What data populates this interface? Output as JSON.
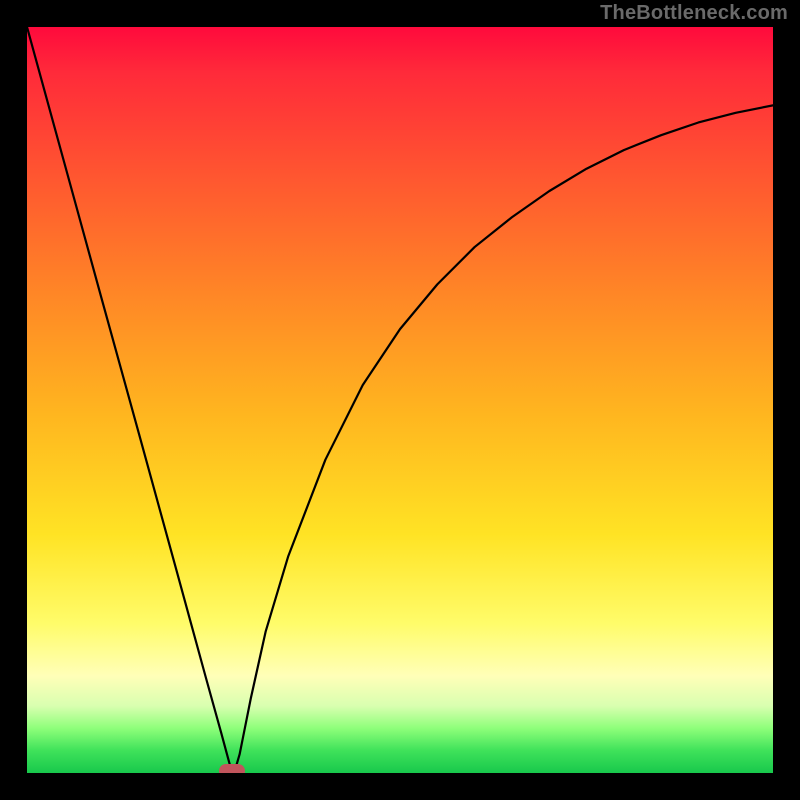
{
  "watermark": {
    "text": "TheBottleneck.com"
  },
  "chart_data": {
    "type": "line",
    "title": "",
    "xlabel": "",
    "ylabel": "",
    "xlim": [
      0,
      100
    ],
    "ylim": [
      0,
      100
    ],
    "grid": false,
    "legend": false,
    "series": [
      {
        "name": "bottleneck-curve",
        "x": [
          0,
          5,
          10,
          15,
          20,
          22,
          24,
          26,
          27,
          27.5,
          28,
          28.5,
          29,
          30,
          32,
          35,
          40,
          45,
          50,
          55,
          60,
          65,
          70,
          75,
          80,
          85,
          90,
          95,
          100
        ],
        "values": [
          100,
          81.8,
          63.6,
          45.5,
          27.3,
          20,
          12.7,
          5.5,
          1.8,
          0,
          0.8,
          2.5,
          5,
          10,
          19,
          29,
          42,
          52,
          59.5,
          65.5,
          70.5,
          74.5,
          78,
          81,
          83.5,
          85.5,
          87.2,
          88.5,
          89.5
        ]
      }
    ],
    "marker": {
      "name": "optimal-point",
      "x": 27.5,
      "y": 0,
      "color": "#c1555c"
    },
    "background_gradient": {
      "top_color": "#ff0a3c",
      "bottom_color": "#18c84c"
    }
  }
}
